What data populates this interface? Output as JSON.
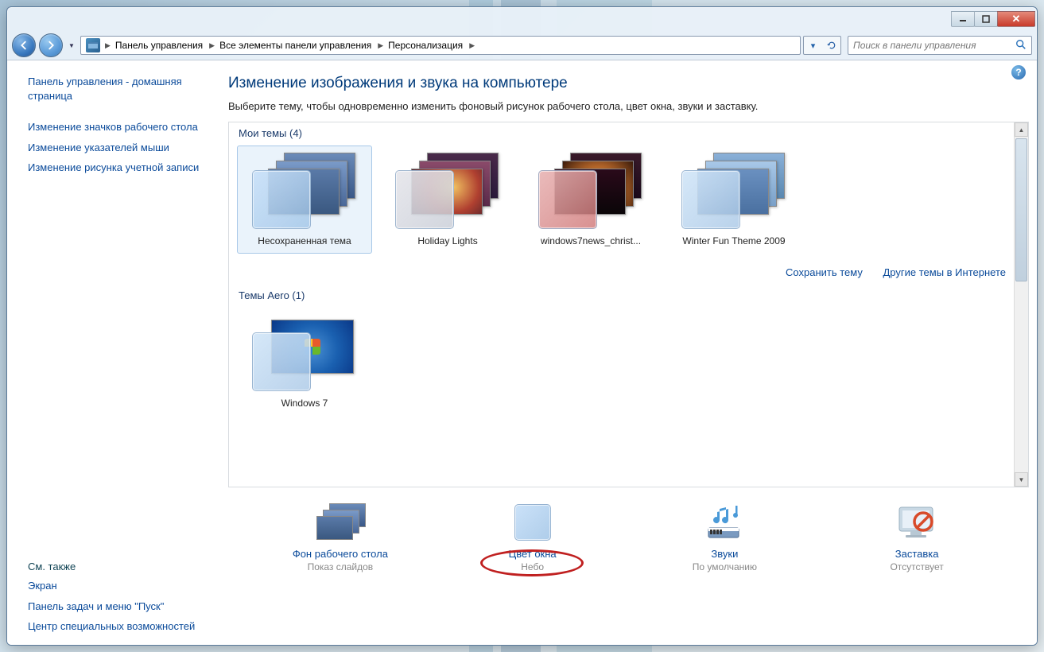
{
  "search": {
    "placeholder": "Поиск в панели управления"
  },
  "breadcrumbs": [
    "Панель управления",
    "Все элементы панели управления",
    "Персонализация"
  ],
  "sidebar": {
    "home": "Панель управления - домашняя страница",
    "links": [
      "Изменение значков рабочего стола",
      "Изменение указателей мыши",
      "Изменение рисунка учетной записи"
    ],
    "seealso_head": "См. также",
    "seealso": [
      "Экран",
      "Панель задач и меню \"Пуск\"",
      "Центр специальных возможностей"
    ]
  },
  "page": {
    "title": "Изменение изображения и звука на компьютере",
    "subtitle": "Выберите тему, чтобы одновременно изменить фоновый рисунок рабочего стола, цвет окна, звуки и заставку."
  },
  "groups": {
    "mine": {
      "label": "Мои темы (4)",
      "items": [
        "Несохраненная тема",
        "Holiday Lights",
        "windows7news_christ...",
        "Winter Fun Theme 2009"
      ]
    },
    "aero": {
      "label": "Темы Aero (1)",
      "items": [
        "Windows 7"
      ]
    }
  },
  "actions": {
    "save": "Сохранить тему",
    "online": "Другие темы в Интернете"
  },
  "bottom": [
    {
      "title": "Фон рабочего стола",
      "sub": "Показ слайдов"
    },
    {
      "title": "Цвет окна",
      "sub": "Небо"
    },
    {
      "title": "Звуки",
      "sub": "По умолчанию"
    },
    {
      "title": "Заставка",
      "sub": "Отсутствует"
    }
  ]
}
